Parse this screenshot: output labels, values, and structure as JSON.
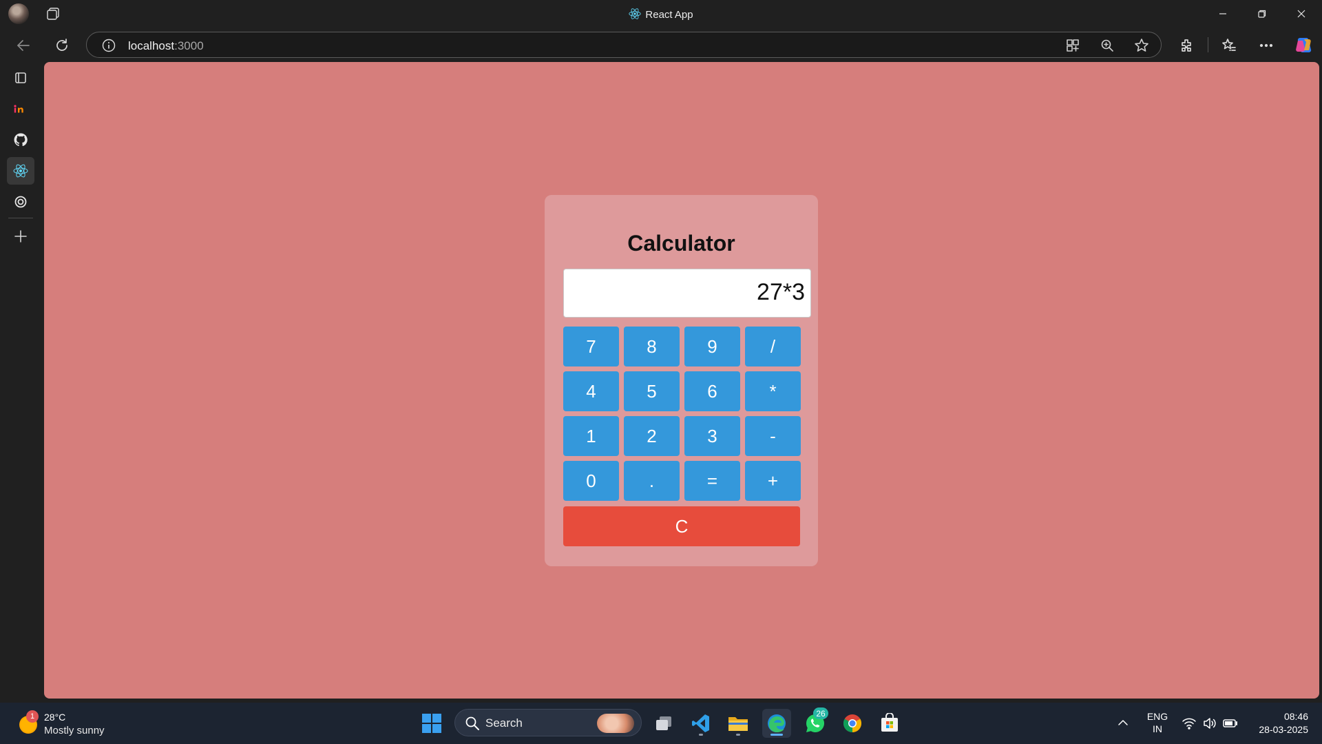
{
  "window": {
    "title": "React App"
  },
  "address_bar": {
    "host": "localhost",
    "port": ":3000"
  },
  "sidebar": {
    "items": [
      {
        "name": "tab-actions"
      },
      {
        "name": "invision"
      },
      {
        "name": "github"
      },
      {
        "name": "react-app",
        "active": true
      },
      {
        "name": "openai"
      },
      {
        "name": "add"
      }
    ]
  },
  "calculator": {
    "title": "Calculator",
    "display": "27*3",
    "keys": [
      "7",
      "8",
      "9",
      "/",
      "4",
      "5",
      "6",
      "*",
      "1",
      "2",
      "3",
      "-",
      "0",
      ".",
      "=",
      "+"
    ],
    "clear_label": "C",
    "colors": {
      "page_bg": "#d67e7c",
      "card_bg": "#de9a9b",
      "key_bg": "#3498db",
      "clear_bg": "#e74c3c"
    }
  },
  "taskbar": {
    "weather": {
      "badge": "1",
      "temperature": "28°C",
      "condition": "Mostly sunny"
    },
    "search_label": "Search",
    "whatsapp_badge": "26",
    "language": {
      "line1": "ENG",
      "line2": "IN"
    },
    "clock": {
      "time": "08:46",
      "date": "28-03-2025"
    }
  }
}
